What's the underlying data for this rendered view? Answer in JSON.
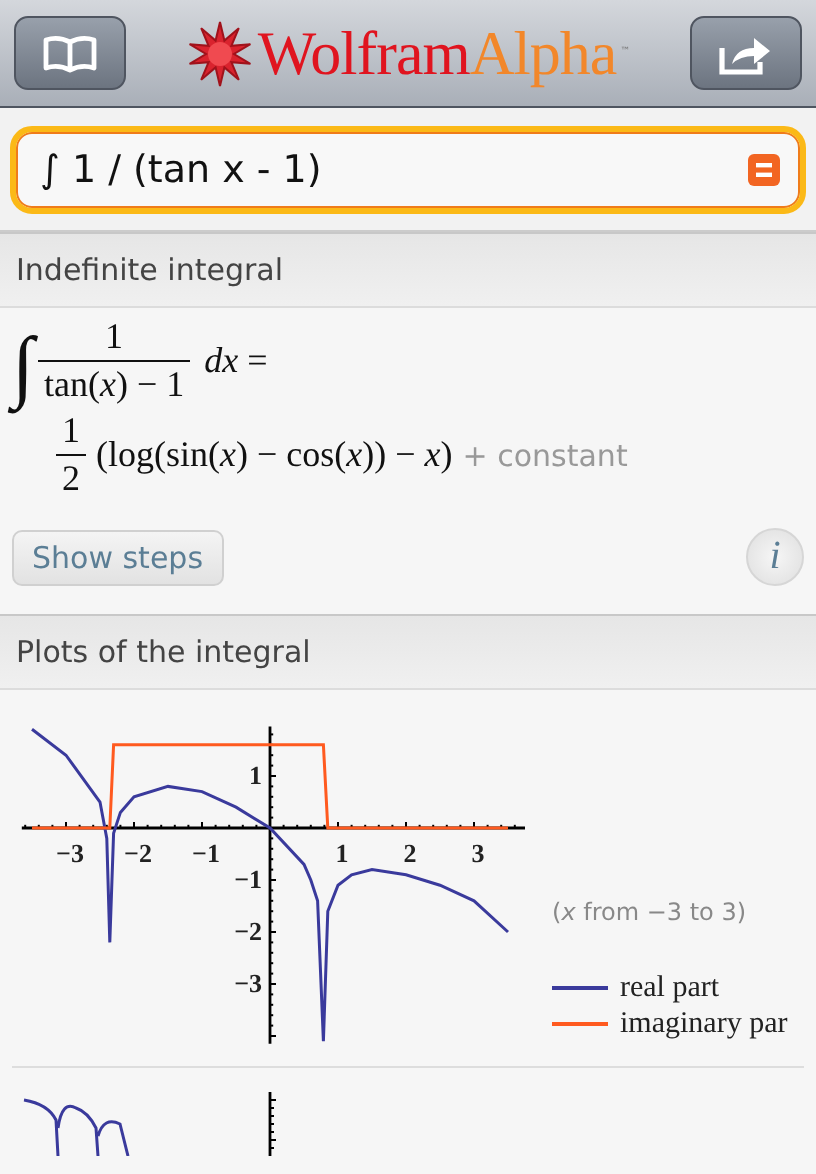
{
  "header": {
    "logo": {
      "name": "Wolfram",
      "suffix": "Alpha",
      "trademark": "™"
    }
  },
  "search": {
    "value": "∫ 1 / (tan x - 1)"
  },
  "pods": [
    {
      "kind": "formula",
      "title": "Indefinite integral",
      "formula": {
        "integral_sign": "∫",
        "numerator": "1",
        "denominator": "tan(*x*) − 1",
        "differential": "*dx* =",
        "coef_numerator": "1",
        "coef_denominator": "2",
        "result": "(log(sin(*x*) − cos(*x*)) − *x*)",
        "constant": "+ constant"
      },
      "button": "Show steps",
      "info": "i"
    },
    {
      "kind": "plots",
      "title": "Plots of the integral",
      "range_note": "(*x* from −3 to 3)",
      "chart_data": {
        "type": "line",
        "x": [
          -3.5,
          -3,
          -2.5,
          -2.4,
          -2.357,
          -2.3,
          -2.2,
          -2,
          -1.5,
          -1,
          -0.5,
          0,
          0.5,
          0.6,
          0.7,
          0.785,
          0.85,
          1,
          1.2,
          1.5,
          2,
          2.5,
          3,
          3.5
        ],
        "series": [
          {
            "name": "real part",
            "color": "#3a3a9c",
            "values": [
              1.9,
              1.4,
              0.5,
              -0.2,
              -2.2,
              -0.1,
              0.3,
              0.6,
              0.8,
              0.7,
              0.4,
              0,
              -0.7,
              -1,
              -1.4,
              -4.1,
              -1.6,
              -1.1,
              -0.9,
              -0.8,
              -0.9,
              -1.1,
              -1.4,
              -2
            ]
          },
          {
            "name": "imaginary par",
            "color": "#ff5a1f",
            "values": [
              0,
              0,
              0,
              0,
              0,
              1.6,
              1.6,
              1.6,
              1.6,
              1.6,
              1.6,
              1.6,
              1.6,
              1.6,
              1.6,
              1.6,
              0,
              0,
              0,
              0,
              0,
              0,
              0,
              0
            ]
          }
        ],
        "xlim": [
          -3.65,
          3.75
        ],
        "ylim": [
          -4.15,
          1.95
        ],
        "xticks": [
          {
            "value": -3,
            "label": "−3"
          },
          {
            "value": -2,
            "label": "−2"
          },
          {
            "value": -1,
            "label": "−1"
          },
          1,
          2,
          3
        ],
        "yticks": [
          1,
          {
            "value": -1,
            "label": "−1"
          },
          {
            "value": -2,
            "label": "−2"
          },
          {
            "value": -3,
            "label": "−3"
          }
        ]
      }
    }
  ]
}
